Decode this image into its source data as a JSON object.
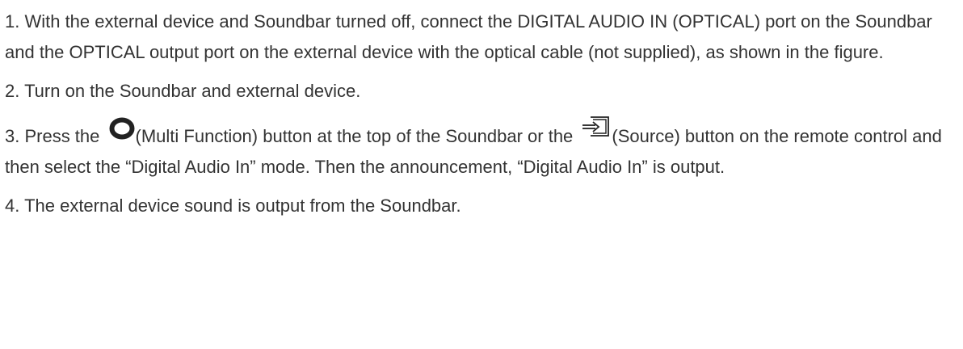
{
  "steps": [
    {
      "text": "1. With the external device and Soundbar turned off, connect the DIGITAL AUDIO IN (OPTICAL) port on the Soundbar and the OPTICAL output port on the external device with the optical cable (not supplied), as shown in the figure."
    },
    {
      "text": "2. Turn on the Soundbar and external device."
    },
    {
      "text_before_multi_icon": "3. Press the ",
      "multi_icon": "multi-function-button-icon",
      "text_between_icons": "(Multi Function) button at the top of the Soundbar or the ",
      "source_icon": "source-button-icon",
      "text_after_source_icon": "(Source) button on the remote control and then select the “Digital Audio In” mode. Then the announcement, “Digital Audio In” is output."
    },
    {
      "text": "4. The external device sound is output from the Soundbar."
    }
  ],
  "colors": {
    "text": "#333333",
    "icon": "#222222",
    "background": "#ffffff"
  }
}
